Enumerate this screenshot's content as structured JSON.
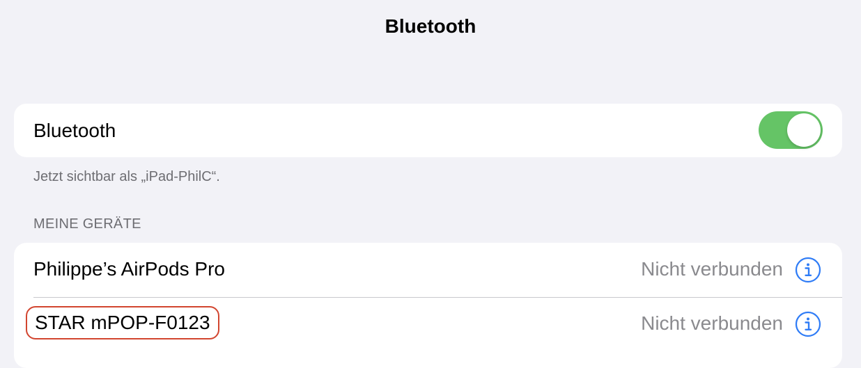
{
  "nav": {
    "title": "Bluetooth"
  },
  "bluetooth_toggle": {
    "label": "Bluetooth",
    "enabled": true,
    "on_color": "#65c466"
  },
  "visibility_note": "Jetzt sichtbar als „iPad-PhilC“.",
  "my_devices": {
    "header": "MEINE GERÄTE",
    "items": [
      {
        "name": "Philippe’s AirPods Pro",
        "status": "Nicht verbunden",
        "icon": "info-icon",
        "highlighted": false
      },
      {
        "name": "STAR mPOP-F0123",
        "status": "Nicht verbunden",
        "icon": "info-icon",
        "highlighted": true
      }
    ]
  },
  "colors": {
    "background": "#f2f2f7",
    "accent_blue": "#2f7cf6",
    "secondary_text": "#8a8a8e",
    "highlight_border": "#d2452f"
  }
}
